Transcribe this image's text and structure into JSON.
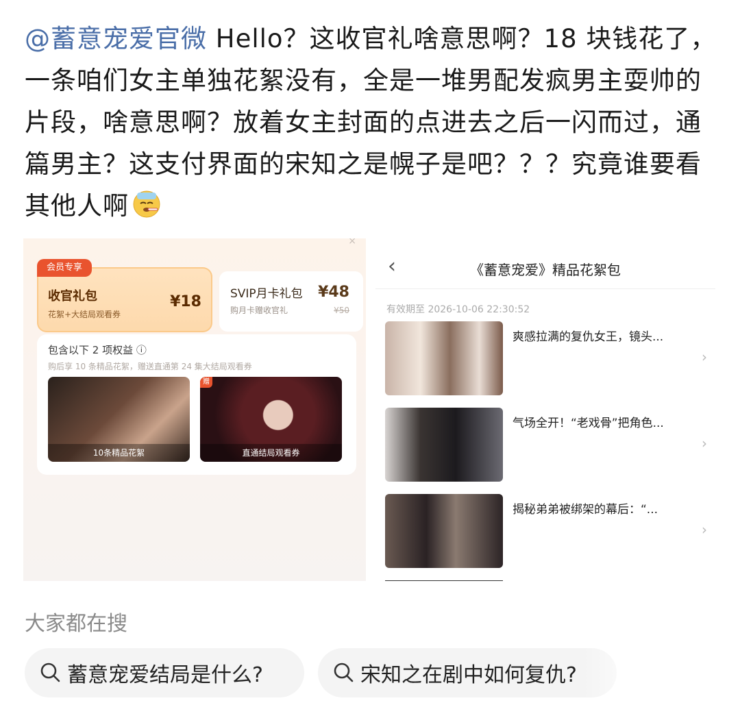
{
  "post": {
    "mention": "@蓄意宠爱官微",
    "body": " Hello？这收官礼啥意思啊？18 块钱花了，一条咱们女主单独花絮没有，全是一堆男配发疯男主耍帅的片段，啥意思啊？放着女主封面的点进去之后一闪而过，通篇男主？这支付界面的宋知之是幌子是吧？？？究竟谁要看其他人啊",
    "emoji": "sick-face-emoji"
  },
  "left_screen": {
    "close": "×",
    "vip_tag": "会员专享",
    "package1": {
      "title": "收官礼包",
      "subtitle": "花絮+大结局观看券",
      "price": "¥18"
    },
    "package2": {
      "title": "SVIP月卡礼包",
      "subtitle": "购月卡赠收官礼",
      "price": "¥48",
      "original_price": "¥50"
    },
    "benefits": {
      "heading": "包含以下 2 项权益 ⓘ",
      "subtext": "购后享 10 条精品花絮，赠送直通第 24 集大结局观看券",
      "thumb1_caption": "10条精品花絮",
      "thumb2_caption": "直通结局观看券",
      "gift_badge": "赠"
    }
  },
  "right_screen": {
    "back": "‹",
    "title": "《蓄意宠爱》精品花絮包",
    "validity": "有效期至 2026-10-06 22:30:52",
    "items": [
      {
        "title": "爽感拉满的复仇女王，镜头..."
      },
      {
        "title": "气场全开！“老戏骨”把角色..."
      },
      {
        "title": "揭秘弟弟被绑架的幕后：“..."
      }
    ],
    "chevron": "›"
  },
  "search": {
    "heading": "大家都在搜",
    "chips": [
      "蓄意宠爱结局是什么?",
      "宋知之在剧中如何复仇?"
    ]
  },
  "colors": {
    "mention": "#4a6ea8",
    "vip": "#e9532e"
  }
}
